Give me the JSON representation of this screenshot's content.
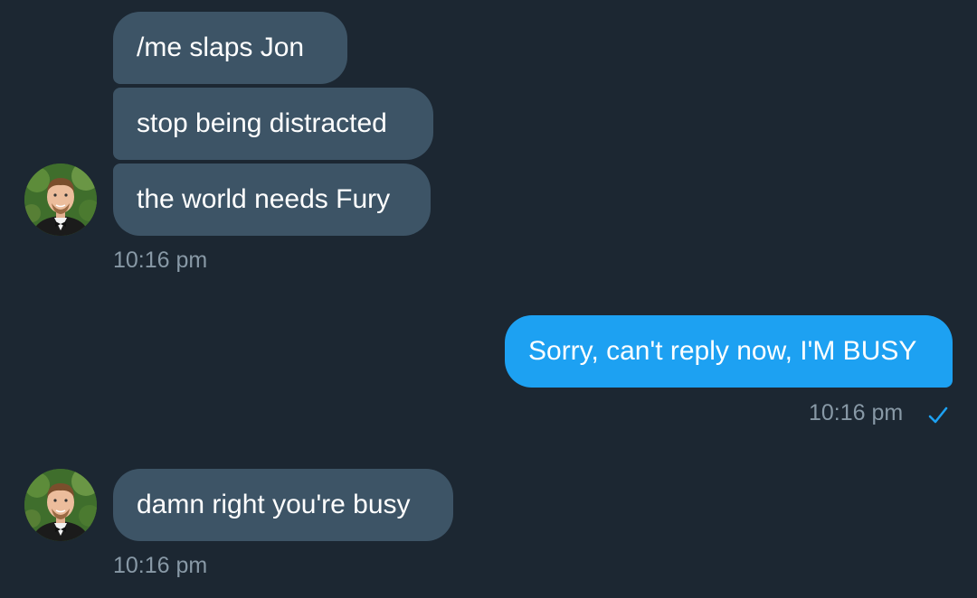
{
  "conversation": {
    "group1": {
      "messages": [
        {
          "text": "/me slaps Jon"
        },
        {
          "text": "stop being distracted"
        },
        {
          "text": "the world needs Fury"
        }
      ],
      "timestamp": "10:16 pm"
    },
    "reply": {
      "text": "Sorry, can't reply now, I'M BUSY",
      "timestamp": "10:16 pm",
      "status_icon": "checkmark-icon"
    },
    "group2": {
      "messages": [
        {
          "text": "damn right you're busy"
        }
      ],
      "timestamp": "10:16 pm"
    }
  },
  "colors": {
    "background": "#1c2732",
    "incoming_bubble": "#3d5466",
    "outgoing_bubble": "#1da1f2",
    "timestamp": "#8899a6",
    "read_check": "#1da1f2"
  }
}
